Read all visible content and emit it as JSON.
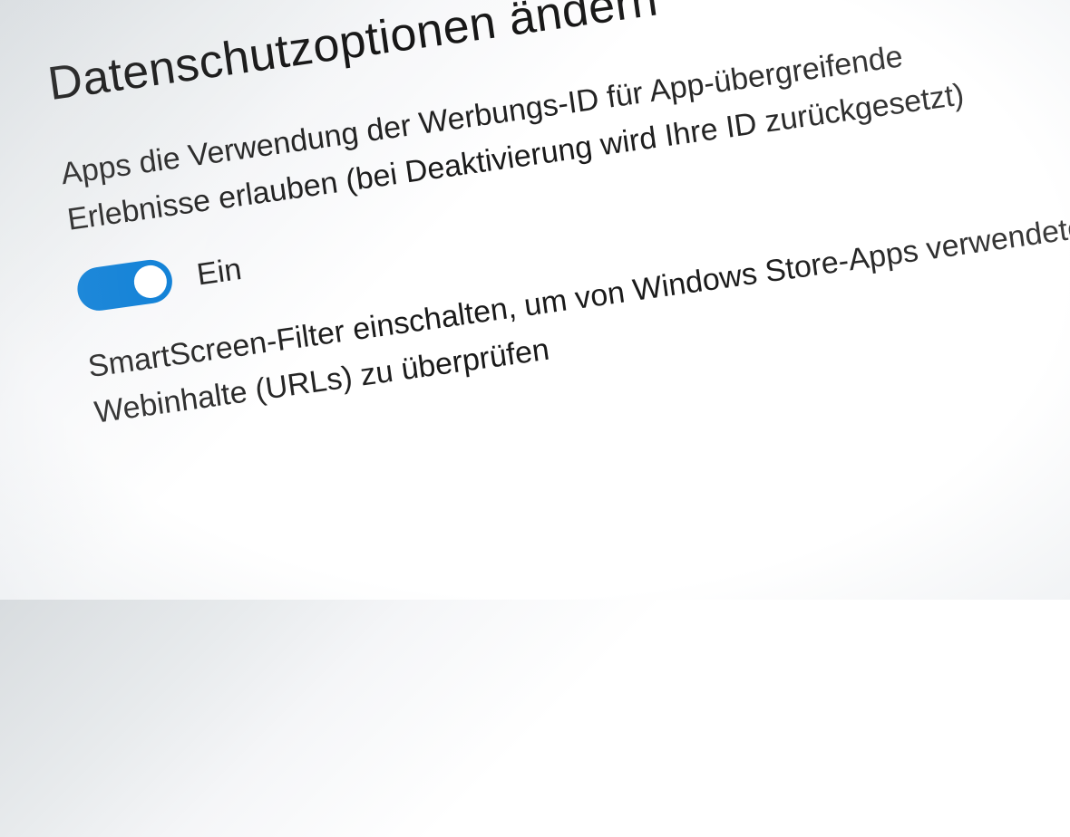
{
  "page": {
    "title": "Datenschutzoptionen ändern"
  },
  "settings": [
    {
      "description_line1": "Apps die Verwendung der Werbungs-ID für App-übergreifende",
      "description_line2": "Erlebnisse erlauben (bei Deaktivierung wird Ihre ID zurückgesetzt)",
      "toggle_state": "Ein"
    },
    {
      "description_line1": "SmartScreen-Filter einschalten, um von Windows Store-Apps verwendete",
      "description_line2": "Webinhalte (URLs) zu überprüfen"
    }
  ]
}
